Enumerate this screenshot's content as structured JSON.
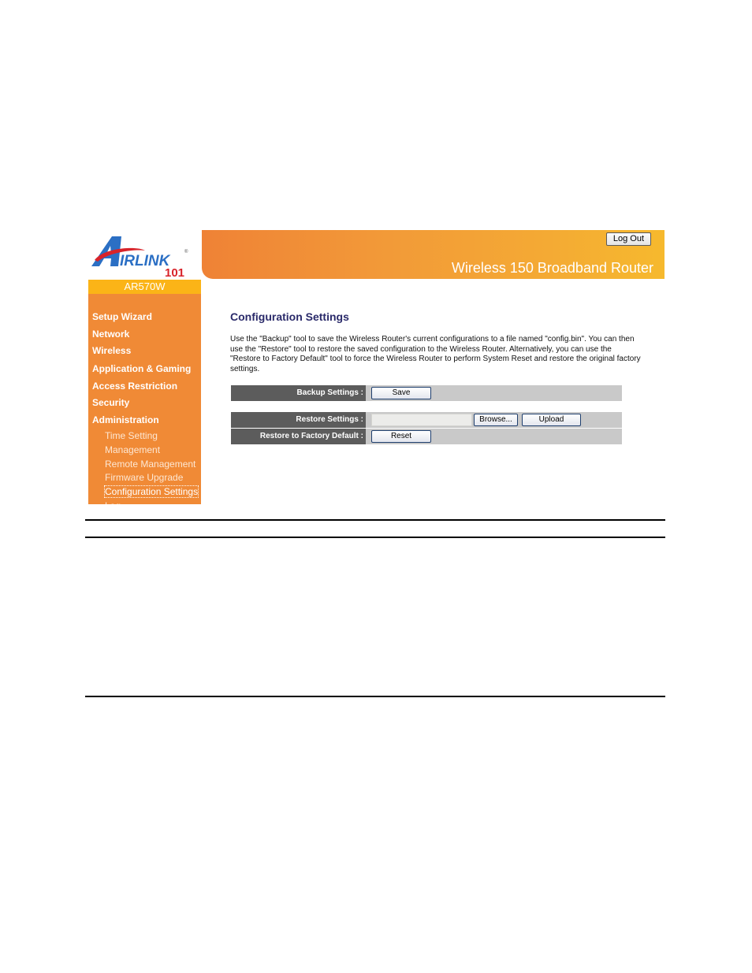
{
  "brand": {
    "logo_text": "AIRLINK",
    "logo_suffix": "101",
    "registered_mark": "®",
    "model": "AR570W",
    "product_title": "Wireless 150 Broadband Router",
    "colors": {
      "logo_blue": "#2b6fc4",
      "logo_red": "#d8232a",
      "banner_start": "#ef8236",
      "banner_end": "#f6b92e",
      "model_bar": "#fbb417",
      "sidebar": "#f08a36"
    }
  },
  "header": {
    "logout_label": "Log Out"
  },
  "sidebar": {
    "main_items": [
      {
        "label": "Setup Wizard"
      },
      {
        "label": "Network"
      },
      {
        "label": "Wireless"
      },
      {
        "label": "Application & Gaming"
      },
      {
        "label": "Access Restriction"
      },
      {
        "label": "Security"
      },
      {
        "label": "Administration"
      }
    ],
    "sub_items": [
      {
        "label": "Time Setting"
      },
      {
        "label": "Management"
      },
      {
        "label": "Remote Management"
      },
      {
        "label": "Firmware Upgrade"
      },
      {
        "label": "Configuration Settings",
        "active": true
      },
      {
        "label": "Log"
      }
    ]
  },
  "main": {
    "title": "Configuration Settings",
    "description": "Use the \"Backup\" tool to save the Wireless Router's current configurations to a file named \"config.bin\". You can then use the \"Restore\" tool to restore the saved configuration to the Wireless Router. Alternatively, you can use the \"Restore to Factory Default\" tool to force the Wireless Router to perform System Reset and restore the original factory settings.",
    "backup": {
      "label": "Backup Settings :",
      "button": "Save"
    },
    "restore": {
      "label": "Restore Settings :",
      "file_value": "",
      "browse_button": "Browse...",
      "upload_button": "Upload"
    },
    "factory": {
      "label": "Restore to Factory Default :",
      "button": "Reset"
    }
  }
}
